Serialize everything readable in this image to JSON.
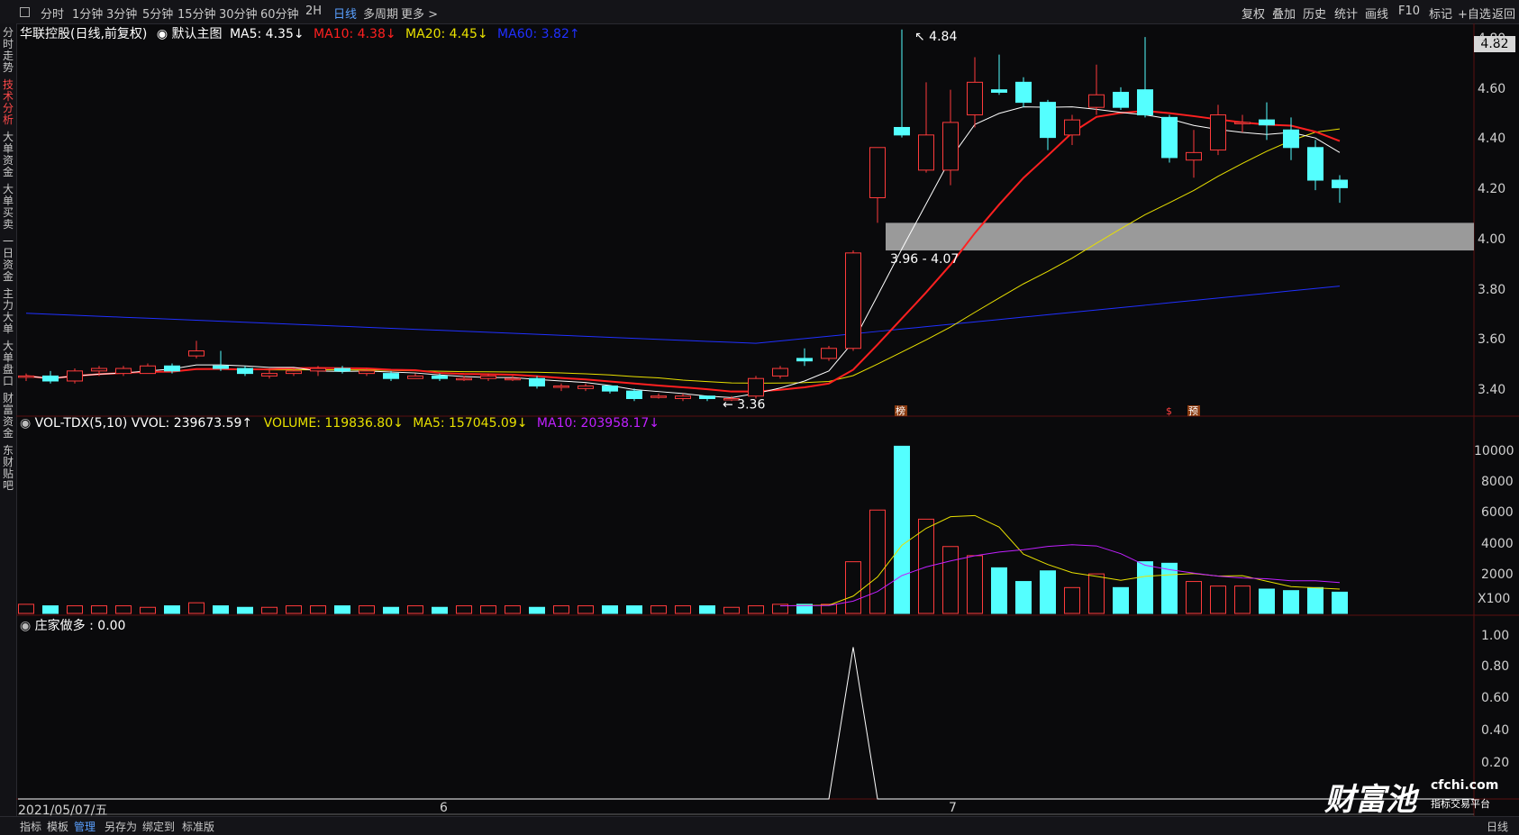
{
  "toolbar": {
    "periods": [
      "分时",
      "1分钟",
      "3分钟",
      "5分钟",
      "15分钟",
      "30分钟",
      "60分钟",
      "2H",
      "日线",
      "多周期",
      "更多 >"
    ],
    "active_period": "日线",
    "tools": [
      "复权",
      "叠加",
      "历史",
      "统计",
      "画线",
      "F10",
      "标记",
      "+自选",
      "返回"
    ]
  },
  "left_tabs": [
    "分时走势",
    "技术分析",
    "大单资金",
    "大单买卖",
    "一日资金",
    "主力大单",
    "大单盘口",
    "财富资金",
    "东财贴吧"
  ],
  "active_left_tab": "技术分析",
  "main_header": {
    "stock": "华联控股(日线,前复权)",
    "template": "默认主图",
    "ma5": "MA5: 4.35↓",
    "ma10": "MA10: 4.38↓",
    "ma20": "MA20: 4.45↓",
    "ma60": "MA60: 3.82↑"
  },
  "vol_header": {
    "name": "VOL-TDX(5,10) VVOL: 239673.59↑",
    "volume": "VOLUME: 119836.80↓",
    "ma5": "MA5: 157045.09↓",
    "ma10": "MA10: 203958.17↓"
  },
  "ind_header": {
    "name": "庄家做多 : 0.00"
  },
  "price_axis": [
    "4.80",
    "4.60",
    "4.40",
    "4.20",
    "4.00",
    "3.80",
    "3.60",
    "3.40"
  ],
  "current_price": "4.82",
  "vol_axis": [
    "10000",
    "8000",
    "6000",
    "4000",
    "2000",
    "X100"
  ],
  "ind_axis": [
    "1.00",
    "0.80",
    "0.60",
    "0.40",
    "0.20"
  ],
  "date_axis": {
    "first": "2021/05/07/五",
    "m6": "6",
    "m7": "7"
  },
  "annotations": {
    "high": "4.84",
    "low": "3.36",
    "zone": "3.96 - 4.07",
    "mark1": "榜",
    "mark2": "$",
    "mark3": "预"
  },
  "footer": {
    "items": [
      "指标",
      "模板",
      "管理",
      "另存为",
      "绑定到",
      "标准版"
    ],
    "active": "管理",
    "right": "日线"
  },
  "watermark": {
    "main": "财富池",
    "site": "cfchi.com",
    "sub": "指标交易平台"
  },
  "colors": {
    "up": "#ff3b3b",
    "down": "#54ffff",
    "ma5": "#ffffff",
    "ma10": "#ff2020",
    "ma20": "#e8e000",
    "ma60": "#2030ff",
    "vol_ma10": "#c020ff"
  },
  "chart_data": {
    "type": "candlestick",
    "ylim": [
      3.3,
      4.85
    ],
    "candles": [
      [
        3.46,
        3.46,
        3.47,
        3.44
      ],
      [
        3.46,
        3.44,
        3.48,
        3.43
      ],
      [
        3.44,
        3.48,
        3.49,
        3.43
      ],
      [
        3.48,
        3.49,
        3.5,
        3.46
      ],
      [
        3.47,
        3.49,
        3.5,
        3.46
      ],
      [
        3.47,
        3.5,
        3.51,
        3.47
      ],
      [
        3.5,
        3.48,
        3.51,
        3.47
      ],
      [
        3.54,
        3.56,
        3.6,
        3.53
      ],
      [
        3.5,
        3.49,
        3.56,
        3.48
      ],
      [
        3.49,
        3.47,
        3.5,
        3.46
      ],
      [
        3.46,
        3.47,
        3.49,
        3.45
      ],
      [
        3.47,
        3.48,
        3.49,
        3.46
      ],
      [
        3.48,
        3.49,
        3.5,
        3.46
      ],
      [
        3.49,
        3.48,
        3.5,
        3.47
      ],
      [
        3.47,
        3.48,
        3.49,
        3.46
      ],
      [
        3.47,
        3.45,
        3.48,
        3.44
      ],
      [
        3.45,
        3.46,
        3.47,
        3.45
      ],
      [
        3.46,
        3.45,
        3.47,
        3.44
      ],
      [
        3.45,
        3.45,
        3.46,
        3.44
      ],
      [
        3.45,
        3.46,
        3.47,
        3.44
      ],
      [
        3.45,
        3.45,
        3.46,
        3.44
      ],
      [
        3.45,
        3.42,
        3.46,
        3.41
      ],
      [
        3.42,
        3.42,
        3.43,
        3.4
      ],
      [
        3.41,
        3.42,
        3.43,
        3.4
      ],
      [
        3.42,
        3.4,
        3.42,
        3.39
      ],
      [
        3.4,
        3.37,
        3.41,
        3.36
      ],
      [
        3.38,
        3.38,
        3.39,
        3.37
      ],
      [
        3.37,
        3.38,
        3.39,
        3.36
      ],
      [
        3.38,
        3.37,
        3.38,
        3.36
      ],
      [
        3.37,
        3.37,
        3.38,
        3.36
      ],
      [
        3.38,
        3.45,
        3.46,
        3.37
      ],
      [
        3.46,
        3.49,
        3.5,
        3.45
      ],
      [
        3.53,
        3.52,
        3.57,
        3.5
      ],
      [
        3.53,
        3.57,
        3.58,
        3.52
      ],
      [
        3.57,
        3.95,
        3.96,
        3.56
      ],
      [
        4.17,
        4.37,
        4.37,
        4.07
      ],
      [
        4.45,
        4.42,
        4.84,
        4.41
      ],
      [
        4.28,
        4.42,
        4.63,
        4.27
      ],
      [
        4.28,
        4.47,
        4.6,
        4.22
      ],
      [
        4.5,
        4.63,
        4.73,
        4.45
      ],
      [
        4.6,
        4.59,
        4.74,
        4.58
      ],
      [
        4.63,
        4.55,
        4.65,
        4.53
      ],
      [
        4.55,
        4.41,
        4.56,
        4.36
      ],
      [
        4.42,
        4.48,
        4.5,
        4.38
      ],
      [
        4.53,
        4.58,
        4.7,
        4.5
      ],
      [
        4.59,
        4.53,
        4.61,
        4.52
      ],
      [
        4.6,
        4.5,
        4.81,
        4.49
      ],
      [
        4.49,
        4.33,
        4.5,
        4.31
      ],
      [
        4.32,
        4.35,
        4.44,
        4.25
      ],
      [
        4.36,
        4.5,
        4.54,
        4.34
      ],
      [
        4.47,
        4.47,
        4.5,
        4.43
      ],
      [
        4.48,
        4.46,
        4.55,
        4.4
      ],
      [
        4.44,
        4.37,
        4.49,
        4.32
      ],
      [
        4.37,
        4.24,
        4.4,
        4.2
      ],
      [
        4.24,
        4.21,
        4.26,
        4.15
      ]
    ],
    "volume": [
      6,
      5,
      5,
      5,
      5,
      4,
      5,
      7,
      5,
      4,
      4,
      5,
      5,
      5,
      5,
      4,
      5,
      4,
      5,
      5,
      5,
      4,
      5,
      5,
      5,
      5,
      5,
      5,
      5,
      4,
      5,
      6,
      6,
      6,
      34,
      68,
      110,
      62,
      44,
      38,
      30,
      21,
      28,
      17,
      26,
      17,
      34,
      33,
      21,
      18,
      18,
      16,
      15,
      17,
      14
    ],
    "indicator": {
      "peak_index": 34,
      "peak_value": 1.0,
      "ylim": [
        0,
        1.05
      ]
    }
  }
}
